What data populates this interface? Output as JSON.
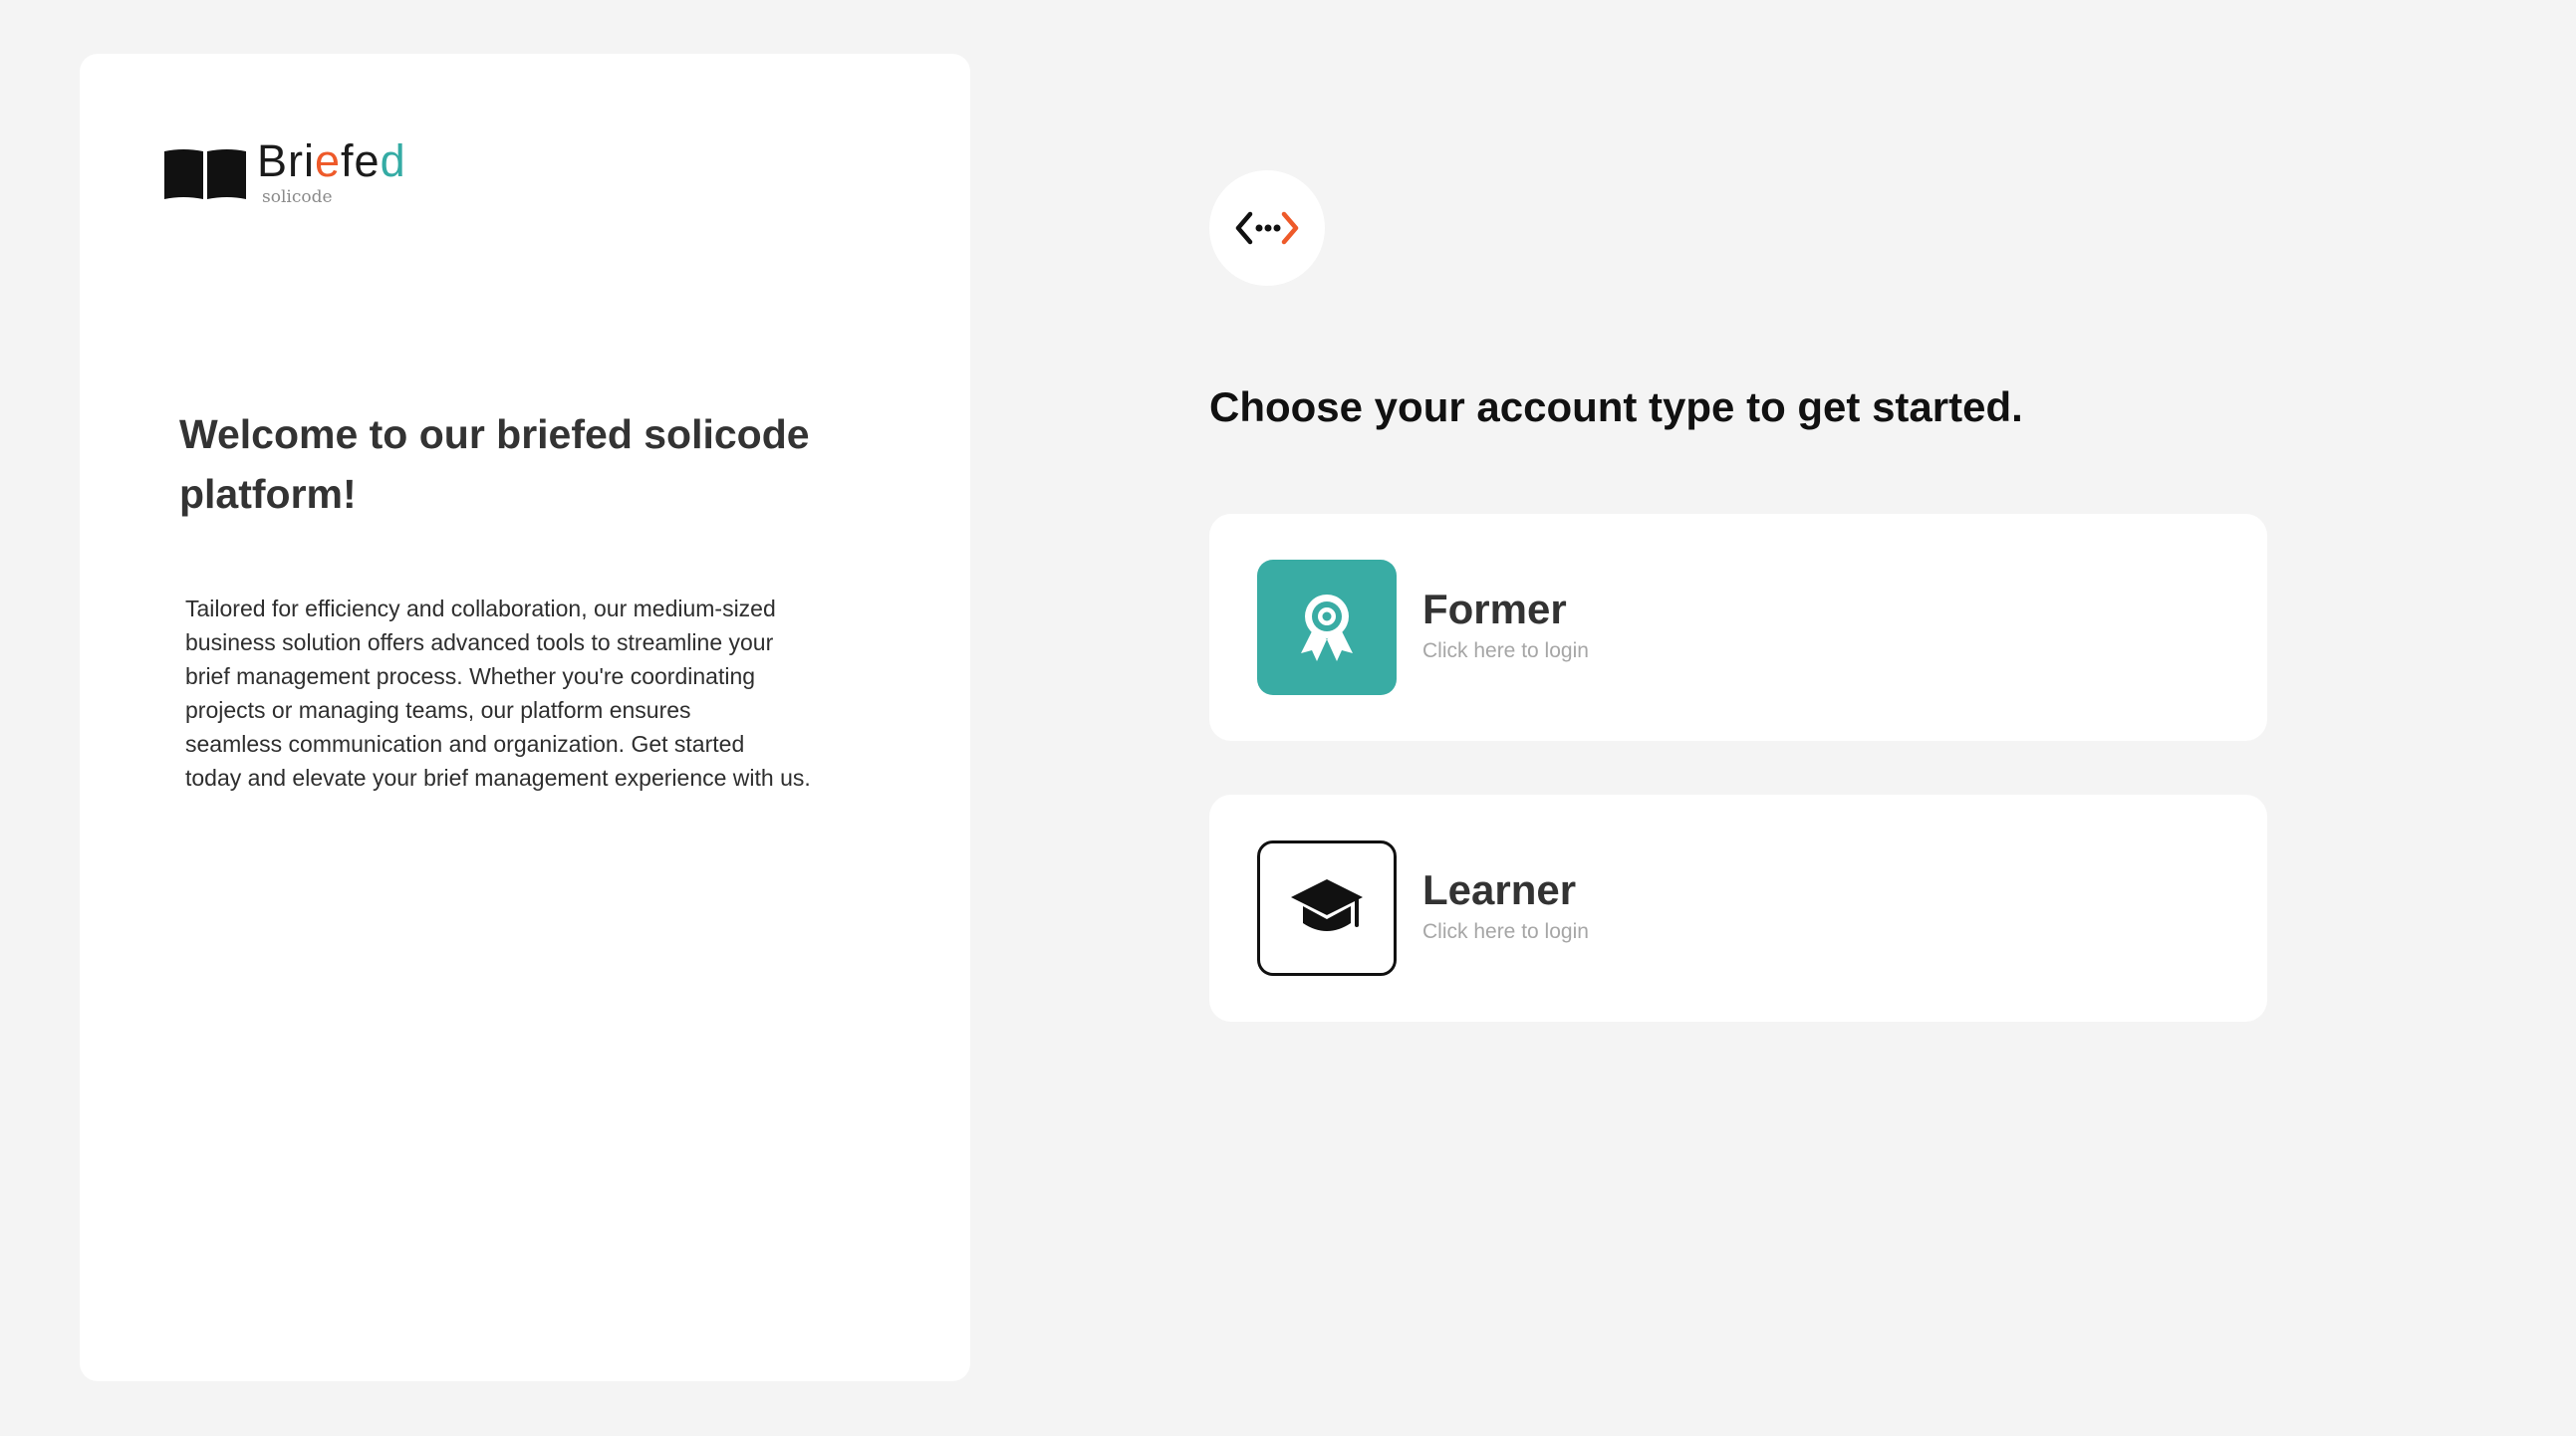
{
  "brand": {
    "name_parts": [
      "Bri",
      "e",
      "fe",
      "d"
    ],
    "subtitle": "solicode",
    "accent_orange": "#ee5a2a",
    "accent_teal": "#34aba4"
  },
  "welcome": {
    "title": "Welcome to our briefed solicode platform!",
    "lines": [
      "Tailored for efficiency and collaboration, our medium-sized",
      "business solution offers advanced tools to streamline your",
      "brief management process. Whether you're coordinating",
      "projects or managing teams, our platform ensures",
      "seamless communication and organization. Get started",
      "today and elevate your brief management experience with us."
    ]
  },
  "code_badge": {
    "icon": "code-arrows-icon"
  },
  "heading": "Choose your account type to get started.",
  "accounts": [
    {
      "title": "Former",
      "subtitle": "Click here to login",
      "icon": "award-ribbon-icon",
      "icon_bg": "#39aca4"
    },
    {
      "title": "Learner",
      "subtitle": "Click here to login",
      "icon": "graduation-cap-icon",
      "icon_bg": "#ffffff"
    }
  ]
}
